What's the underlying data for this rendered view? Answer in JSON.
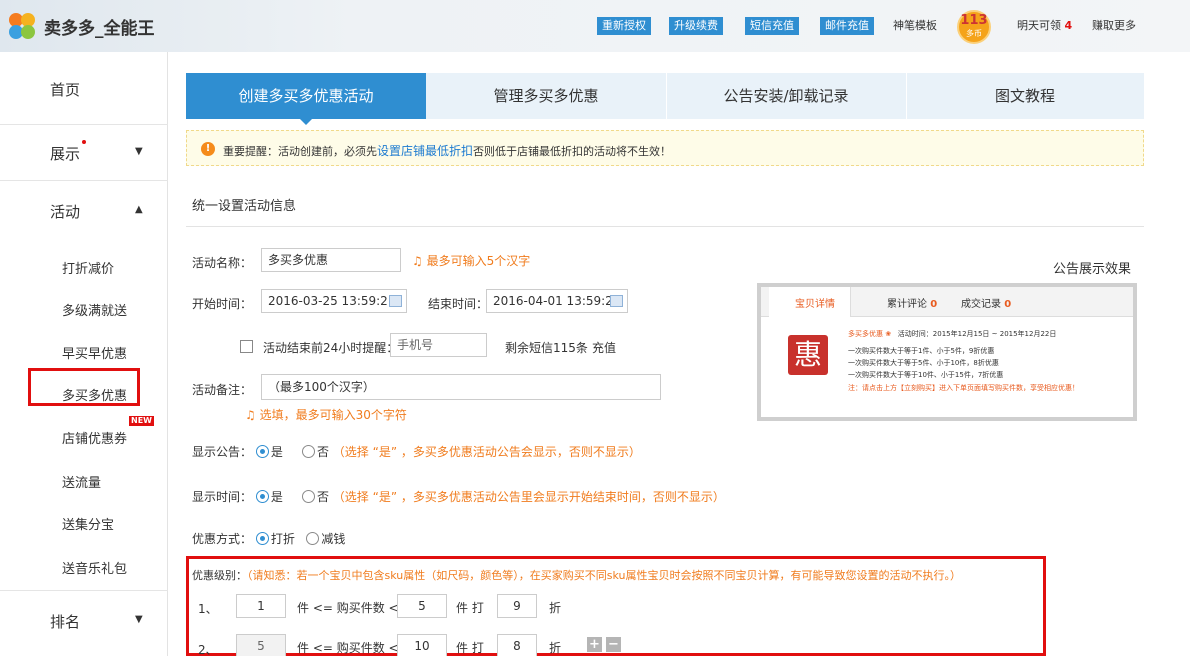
{
  "header": {
    "brand": "卖多多_全能王",
    "buttons": [
      "重新授权",
      "升级续费",
      "短信充值",
      "邮件充值"
    ],
    "template_link": "神笔模板",
    "coins": {
      "count": "113",
      "unit": "多币"
    },
    "tomorrow_prefix": "明天可领",
    "tomorrow_count": "4",
    "earn_more": "赚取更多"
  },
  "sidebar": {
    "home": "首页",
    "display": "展示",
    "activity": "活动",
    "subitems": [
      "打折减价",
      "多级满就送",
      "早买早优惠",
      "多买多优惠",
      "店铺优惠券",
      "送流量",
      "送集分宝",
      "送音乐礼包"
    ],
    "new_badge": "NEW",
    "ranking": "排名",
    "arrow_down": "▼",
    "arrow_up": "▲"
  },
  "tabs": [
    "创建多买多优惠活动",
    "管理多买多优惠",
    "公告安装/卸载记录",
    "图文教程"
  ],
  "notice": {
    "icon": "!",
    "prefix": "重要提醒：活动创建前，必须先",
    "link": "设置店铺最低折扣",
    "suffix": "否则低于店铺最低折扣的活动将不生效！"
  },
  "section_title": "统一设置活动信息",
  "form": {
    "name_label": "活动名称：",
    "name_value": "多买多优惠",
    "name_hint": "最多可输入5个汉字",
    "start_label": "开始时间：",
    "start_value": "2016-03-25 13:59:21",
    "end_label": "结束时间：",
    "end_value": "2016-04-01 13:59:21",
    "remind_label": "活动结束前24小时提醒：",
    "phone_placeholder": "手机号",
    "sms_left": "剩余短信115条",
    "recharge": "充值",
    "remark_label": "活动备注：",
    "remark_placeholder": "（最多100个汉字）",
    "remark_hint": "选填，最多可输入30个字符",
    "show_notice_label": "显示公告：",
    "show_time_label": "显示时间：",
    "yes": "是",
    "no": "否",
    "show_notice_hint": "（选择 “是” ，多买多优惠活动公告会显示，否则不显示）",
    "show_time_hint": "（选择 “是” ，多买多优惠活动公告里会显示开始结束时间，否则不显示）",
    "discount_label": "优惠方式：",
    "discount_opt1": "打折",
    "discount_opt2": "减钱",
    "level_label": "优惠级别：",
    "level_hint": "（请知悉：若一个宝贝中包含sku属性（如尺码，颜色等），在买家购买不同sku属性宝贝时会按照不同宝贝计算，有可能导致您设置的活动不执行。）",
    "levels": [
      {
        "idx": "1、",
        "from": "1",
        "to": "5",
        "discount": "9"
      },
      {
        "idx": "2、",
        "from": "5",
        "to": "10",
        "discount": "8"
      }
    ],
    "piece_le": "件 <= 购买件数 <",
    "piece_hit": "件 打",
    "zhe": "折",
    "plus": "+",
    "minus": "−"
  },
  "preview": {
    "title": "公告展示效果",
    "tab1": "宝贝详情",
    "tab2": "累计评论",
    "tab2_count": "0",
    "tab3": "成交记录",
    "tab3_count": "0",
    "logo_char": "惠",
    "line1_name": "多买多优惠",
    "line1_time": "活动时间：2015年12月15日 ~ 2015年12月22日",
    "rules": [
      "一次购买件数大于等于1件、小于5件，9折优惠",
      "一次购买件数大于等于5件、小于10件，8折优惠",
      "一次购买件数大于等于10件、小于15件，7折优惠"
    ],
    "note": "注：请点击上方【立刻购买】进入下单页面填写购买件数，享受相应优惠！"
  }
}
